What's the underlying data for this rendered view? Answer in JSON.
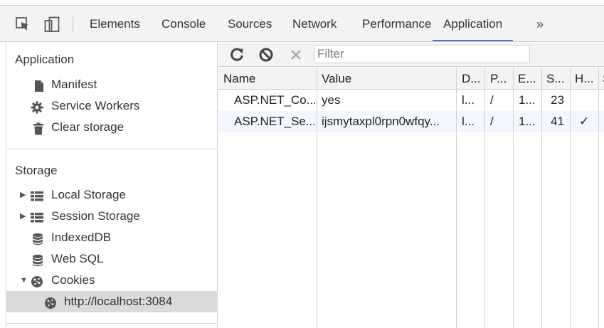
{
  "tabs": {
    "items": [
      {
        "label": "Elements"
      },
      {
        "label": "Console"
      },
      {
        "label": "Sources"
      },
      {
        "label": "Network"
      },
      {
        "label": "Performance"
      },
      {
        "label": "Application"
      }
    ],
    "active": "Application",
    "overflow_label": "»"
  },
  "icons": {
    "inspect": "element-picker-icon",
    "device": "device-toolbar-icon",
    "manifest": "document-icon",
    "service_workers": "gear-icon",
    "clear_storage": "trash-icon",
    "local_storage": "grid-icon",
    "session_storage": "grid-icon",
    "indexeddb": "database-icon",
    "web_sql": "database-icon",
    "cookies": "cookie-icon",
    "refresh": "refresh-icon",
    "clear_all": "block-icon",
    "delete": "close-icon"
  },
  "sidebar": {
    "application_header": "Application",
    "application_items": [
      {
        "label": "Manifest"
      },
      {
        "label": "Service Workers"
      },
      {
        "label": "Clear storage"
      }
    ],
    "storage_header": "Storage",
    "storage_items": [
      {
        "label": "Local Storage",
        "expander": "▶"
      },
      {
        "label": "Session Storage",
        "expander": "▶"
      },
      {
        "label": "IndexedDB"
      },
      {
        "label": "Web SQL"
      },
      {
        "label": "Cookies",
        "expander": "▼"
      },
      {
        "label": "http://localhost:3084",
        "selected": true
      }
    ]
  },
  "toolbar": {
    "filter_placeholder": "Filter"
  },
  "table": {
    "columns": [
      "Name",
      "Value",
      "D...",
      "P...",
      "E...",
      "S...",
      "H...",
      "S"
    ],
    "rows": [
      {
        "name": "ASP.NET_Co...",
        "value": "yes",
        "domain": "l...",
        "path": "/",
        "expires": "1...",
        "size": "23",
        "httponly": ""
      },
      {
        "name": "ASP.NET_Se...",
        "value": "ijsmytaxpl0rpn0wfqy...",
        "domain": "l...",
        "path": "/",
        "expires": "1...",
        "size": "41",
        "httponly": "✓"
      }
    ]
  },
  "colors": {
    "active_tab_underline": "#3879d9",
    "selected_row": "#dadada",
    "alt_row": "#f2f7fd"
  }
}
